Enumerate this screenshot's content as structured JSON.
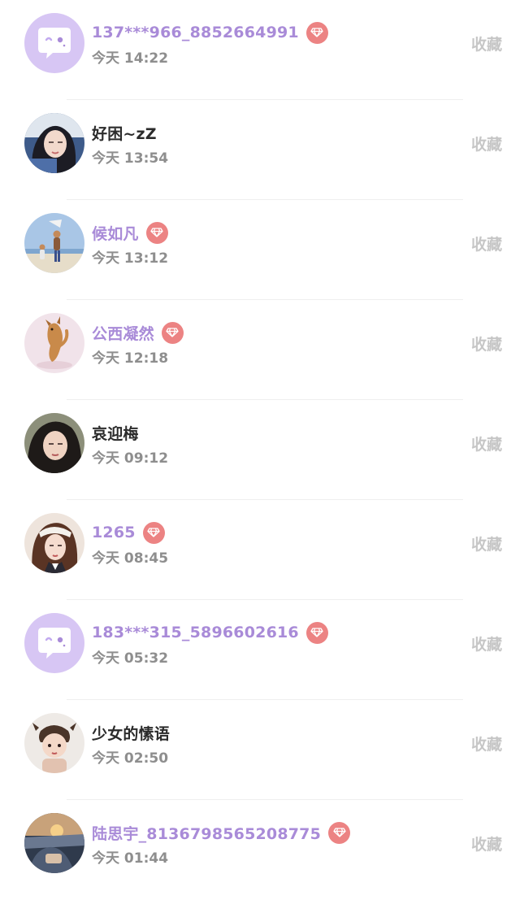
{
  "users": [
    {
      "name": "137***966_8852664991",
      "time": "今天 14:22",
      "vip": true,
      "avatar": "default-chat-avatar",
      "action": "收藏"
    },
    {
      "name": "好困~zZ",
      "time": "今天 13:54",
      "vip": false,
      "avatar": "photo-avatar",
      "action": "收藏"
    },
    {
      "name": "候如凡",
      "time": "今天 13:12",
      "vip": true,
      "avatar": "photo-avatar",
      "action": "收藏"
    },
    {
      "name": "公西凝然",
      "time": "今天 12:18",
      "vip": true,
      "avatar": "photo-avatar",
      "action": "收藏"
    },
    {
      "name": "哀迎梅",
      "time": "今天 09:12",
      "vip": false,
      "avatar": "photo-avatar",
      "action": "收藏"
    },
    {
      "name": "1265",
      "time": "今天 08:45",
      "vip": true,
      "avatar": "photo-avatar",
      "action": "收藏"
    },
    {
      "name": "183***315_5896602616",
      "time": "今天 05:32",
      "vip": true,
      "avatar": "default-chat-avatar",
      "action": "收藏"
    },
    {
      "name": "少女的愫语",
      "time": "今天 02:50",
      "vip": false,
      "avatar": "photo-avatar",
      "action": "收藏"
    },
    {
      "name": "陆思宇_8136798565208775",
      "time": "今天 01:44",
      "vip": true,
      "avatar": "photo-avatar",
      "action": "收藏"
    }
  ],
  "colors": {
    "vip_name": "#a98bd8",
    "normal_name": "#2b2b2b",
    "time_text": "#8e8e8e",
    "action_text": "#c6c6c6",
    "vip_badge": "#ec8383",
    "default_avatar_bg": "#d7c6f4"
  }
}
